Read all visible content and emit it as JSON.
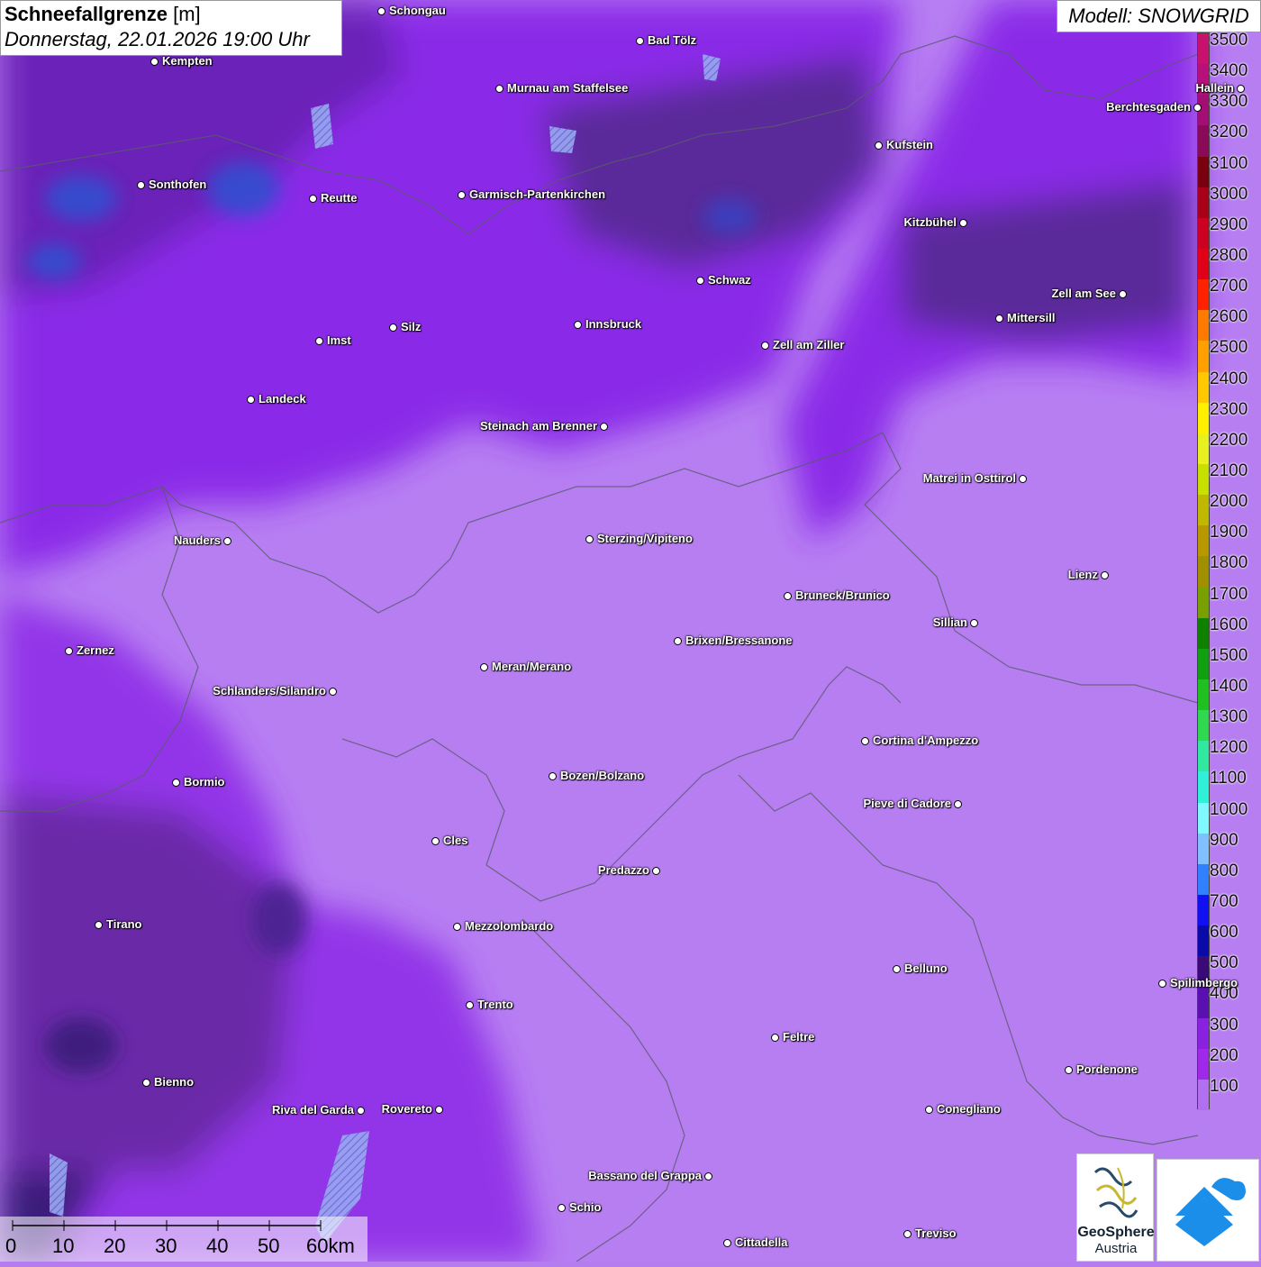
{
  "header": {
    "title_bold": "Schneefallgrenze",
    "title_unit": "[m]",
    "datetime": "Donnerstag, 22.01.2026 19:00 Uhr"
  },
  "model_label": "Modell: SNOWGRID",
  "legend": {
    "levels": [
      "3500",
      "3400",
      "3300",
      "3200",
      "3100",
      "3000",
      "2900",
      "2800",
      "2700",
      "2600",
      "2500",
      "2400",
      "2300",
      "2200",
      "2100",
      "2000",
      "1900",
      "1800",
      "1700",
      "1600",
      "1500",
      "1400",
      "1300",
      "1200",
      "1100",
      "1000",
      "900",
      "800",
      "700",
      "600",
      "500",
      "400",
      "300",
      "200",
      "100"
    ],
    "colors": [
      "#c8106e",
      "#b8107a",
      "#a20e74",
      "#8a0a5a",
      "#7a0010",
      "#a80018",
      "#cc0020",
      "#e00018",
      "#ff2200",
      "#ff7a00",
      "#ffa000",
      "#ffc800",
      "#fff000",
      "#e8f020",
      "#c8e000",
      "#c0b800",
      "#b89800",
      "#a09000",
      "#78a000",
      "#108000",
      "#10a010",
      "#20c020",
      "#30d850",
      "#30e8a0",
      "#30f0d8",
      "#80f8ff",
      "#80c0ff",
      "#3080ff",
      "#1010f0",
      "#0a0aa8",
      "#3a0a78",
      "#5a10b0",
      "#8a20e0",
      "#a028e8",
      "#b070f0"
    ]
  },
  "cities": [
    {
      "name": "Schongau"
    },
    {
      "name": "Kempten"
    },
    {
      "name": "Bad Tölz"
    },
    {
      "name": "Murnau am Staffelsee"
    },
    {
      "name": "Berchtesgaden"
    },
    {
      "name": "Hallein"
    },
    {
      "name": "Kufstein"
    },
    {
      "name": "Sonthofen"
    },
    {
      "name": "Reutte"
    },
    {
      "name": "Garmisch-Partenkirchen"
    },
    {
      "name": "Kitzbühel"
    },
    {
      "name": "Schwaz"
    },
    {
      "name": "Zell am See"
    },
    {
      "name": "Mittersill"
    },
    {
      "name": "Imst"
    },
    {
      "name": "Silz"
    },
    {
      "name": "Innsbruck"
    },
    {
      "name": "Zell am Ziller"
    },
    {
      "name": "Landeck"
    },
    {
      "name": "Steinach am Brenner"
    },
    {
      "name": "Matrei in Osttirol"
    },
    {
      "name": "Nauders"
    },
    {
      "name": "Sterzing/Vipiteno"
    },
    {
      "name": "Lienz"
    },
    {
      "name": "Bruneck/Brunico"
    },
    {
      "name": "Sillian"
    },
    {
      "name": "Zernez"
    },
    {
      "name": "Brixen/Bressanone"
    },
    {
      "name": "Meran/Merano"
    },
    {
      "name": "Schlanders/Silandro"
    },
    {
      "name": "Cortina d'Ampezzo"
    },
    {
      "name": "Bozen/Bolzano"
    },
    {
      "name": "Bormio"
    },
    {
      "name": "Pieve di Cadore"
    },
    {
      "name": "Cles"
    },
    {
      "name": "Predazzo"
    },
    {
      "name": "Tirano"
    },
    {
      "name": "Mezzolombardo"
    },
    {
      "name": "Belluno"
    },
    {
      "name": "Spilimbergo"
    },
    {
      "name": "Trento"
    },
    {
      "name": "Feltre"
    },
    {
      "name": "Pordenone"
    },
    {
      "name": "Bienno"
    },
    {
      "name": "Riva del Garda"
    },
    {
      "name": "Rovereto"
    },
    {
      "name": "Conegliano"
    },
    {
      "name": "Bassano del Grappa"
    },
    {
      "name": "Schio"
    },
    {
      "name": "Treviso"
    },
    {
      "name": "Cittadella"
    }
  ],
  "scale": {
    "ticks": [
      "0",
      "10",
      "20",
      "30",
      "40",
      "50"
    ],
    "last": "60km"
  },
  "logos": {
    "geosphere_line1": "GeoSphere",
    "geosphere_line2": "Austria"
  }
}
